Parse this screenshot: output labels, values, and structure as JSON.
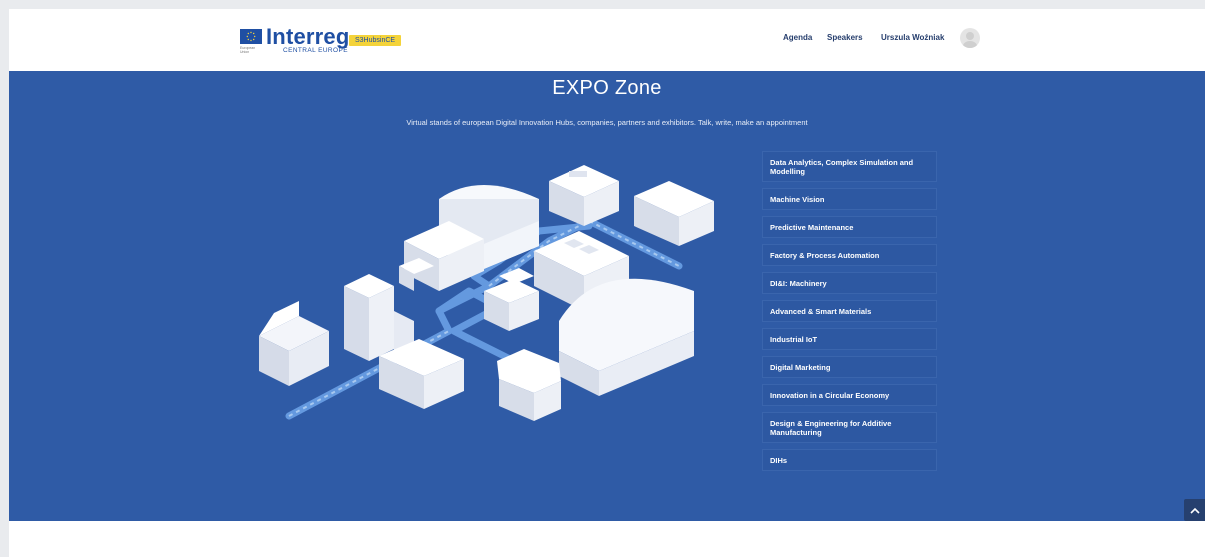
{
  "header": {
    "logo": {
      "word": "Interreg",
      "sub": "CENTRAL EUROPE",
      "badge": "S3HubsinCE",
      "eu_caption": "European Union"
    },
    "nav": [
      "Agenda",
      "Speakers",
      "Urszula Woźniak"
    ],
    "avatar_icon": "user-avatar-icon"
  },
  "hero": {
    "title": "EXPO Zone",
    "subtitle": "Virtual stands of european Digital Innovation Hubs, companies, partners and exhibitors. Talk, write, make an appointment",
    "illustration_icon": "isometric-factory-buildings",
    "background_color": "#2f5ba6"
  },
  "categories": [
    "Data Analytics, Complex Simulation and Modelling",
    "Machine Vision",
    "Predictive Maintenance",
    "Factory & Process Automation",
    "DI&I: Machinery",
    "Advanced & Smart Materials",
    "Industrial IoT",
    "Digital Marketing",
    "Innovation in a Circular Economy",
    "Design & Engineering for Additive Manufacturing",
    "DIHs"
  ],
  "scroll_top_icon": "chevron-up-icon"
}
